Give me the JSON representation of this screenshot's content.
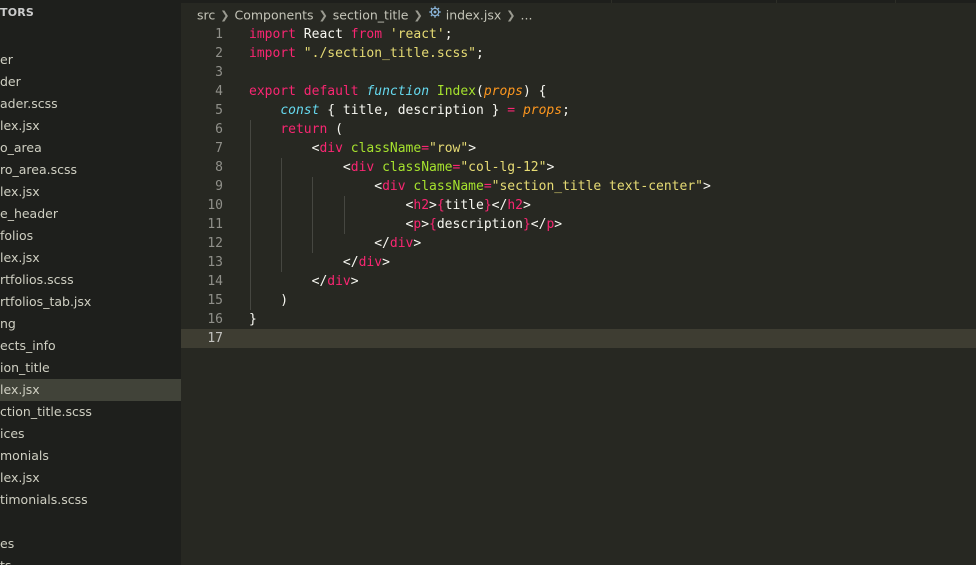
{
  "sidebar": {
    "header": "TORS",
    "items": [
      {
        "label": "er",
        "active": false
      },
      {
        "label": "der",
        "active": false
      },
      {
        "label": "ader.scss",
        "active": false
      },
      {
        "label": "lex.jsx",
        "active": false
      },
      {
        "label": "o_area",
        "active": false
      },
      {
        "label": "ro_area.scss",
        "active": false
      },
      {
        "label": "lex.jsx",
        "active": false
      },
      {
        "label": "e_header",
        "active": false
      },
      {
        "label": "folios",
        "active": false
      },
      {
        "label": "lex.jsx",
        "active": false
      },
      {
        "label": "rtfolios.scss",
        "active": false
      },
      {
        "label": "rtfolios_tab.jsx",
        "active": false
      },
      {
        "label": "ng",
        "active": false
      },
      {
        "label": "ects_info",
        "active": false
      },
      {
        "label": "ion_title",
        "active": false
      },
      {
        "label": "lex.jsx",
        "active": true
      },
      {
        "label": "ction_title.scss",
        "active": false
      },
      {
        "label": "ices",
        "active": false
      },
      {
        "label": "monials",
        "active": false
      },
      {
        "label": "lex.jsx",
        "active": false
      },
      {
        "label": "timonials.scss",
        "active": false
      },
      {
        "label": "",
        "active": false
      },
      {
        "label": "es",
        "active": false
      },
      {
        "label": "ts",
        "active": false
      }
    ]
  },
  "breadcrumb": {
    "parts": [
      "src",
      "Components",
      "section_title",
      "index.jsx",
      "..."
    ],
    "file_icon": "react-gear-icon"
  },
  "editor": {
    "current_line": 17,
    "line_numbers": [
      "1",
      "2",
      "3",
      "4",
      "5",
      "6",
      "7",
      "8",
      "9",
      "10",
      "11",
      "12",
      "13",
      "14",
      "15",
      "16",
      "17"
    ],
    "lines": [
      [
        [
          "kw",
          "import"
        ],
        [
          "pl",
          " React "
        ],
        [
          "kw",
          "from"
        ],
        [
          "pl",
          " "
        ],
        [
          "str",
          "'react'"
        ],
        [
          "pl",
          ";"
        ]
      ],
      [
        [
          "kw",
          "import"
        ],
        [
          "pl",
          " "
        ],
        [
          "str",
          "\"./section_title.scss\""
        ],
        [
          "pl",
          ";"
        ]
      ],
      [],
      [
        [
          "kw",
          "export"
        ],
        [
          "pl",
          " "
        ],
        [
          "kw",
          "default"
        ],
        [
          "pl",
          " "
        ],
        [
          "it",
          "function"
        ],
        [
          "pl",
          " "
        ],
        [
          "fn",
          "Index"
        ],
        [
          "pl",
          "("
        ],
        [
          "param",
          "props"
        ],
        [
          "pl",
          ") {"
        ]
      ],
      [
        [
          "pl",
          "    "
        ],
        [
          "it",
          "const"
        ],
        [
          "pl",
          " { title, description } "
        ],
        [
          "kw",
          "="
        ],
        [
          "pl",
          " "
        ],
        [
          "param",
          "props"
        ],
        [
          "pl",
          ";"
        ]
      ],
      [
        [
          "pl",
          "    "
        ],
        [
          "kw",
          "return"
        ],
        [
          "pl",
          " ("
        ]
      ],
      [
        [
          "pl",
          "        <"
        ],
        [
          "tag",
          "div"
        ],
        [
          "pl",
          " "
        ],
        [
          "attr",
          "className"
        ],
        [
          "kw",
          "="
        ],
        [
          "str",
          "\"row\""
        ],
        [
          "pl",
          ">"
        ]
      ],
      [
        [
          "pl",
          "            <"
        ],
        [
          "tag",
          "div"
        ],
        [
          "pl",
          " "
        ],
        [
          "attr",
          "className"
        ],
        [
          "kw",
          "="
        ],
        [
          "str",
          "\"col-lg-12\""
        ],
        [
          "pl",
          ">"
        ]
      ],
      [
        [
          "pl",
          "                <"
        ],
        [
          "tag",
          "div"
        ],
        [
          "pl",
          " "
        ],
        [
          "attr",
          "className"
        ],
        [
          "kw",
          "="
        ],
        [
          "str",
          "\"section_title text-center\""
        ],
        [
          "pl",
          ">"
        ]
      ],
      [
        [
          "pl",
          "                    <"
        ],
        [
          "tag",
          "h2"
        ],
        [
          "pl",
          ">"
        ],
        [
          "br",
          "{"
        ],
        [
          "pl",
          "title"
        ],
        [
          "br",
          "}"
        ],
        [
          "pl",
          "</"
        ],
        [
          "tag",
          "h2"
        ],
        [
          "pl",
          ">"
        ]
      ],
      [
        [
          "pl",
          "                    <"
        ],
        [
          "tag",
          "p"
        ],
        [
          "pl",
          ">"
        ],
        [
          "br",
          "{"
        ],
        [
          "pl",
          "description"
        ],
        [
          "br",
          "}"
        ],
        [
          "pl",
          "</"
        ],
        [
          "tag",
          "p"
        ],
        [
          "pl",
          ">"
        ]
      ],
      [
        [
          "pl",
          "                </"
        ],
        [
          "tag",
          "div"
        ],
        [
          "pl",
          ">"
        ]
      ],
      [
        [
          "pl",
          "            </"
        ],
        [
          "tag",
          "div"
        ],
        [
          "pl",
          ">"
        ]
      ],
      [
        [
          "pl",
          "        </"
        ],
        [
          "tag",
          "div"
        ],
        [
          "pl",
          ">"
        ]
      ],
      [
        [
          "pl",
          "    )"
        ]
      ],
      [
        [
          "pl",
          "}"
        ]
      ],
      []
    ]
  },
  "colors": {
    "editor_bg": "#272822",
    "sidebar_bg": "#1e1f1c",
    "active_item_bg": "#414339",
    "keyword": "#f92672",
    "string": "#e6db74",
    "function": "#a6e22e",
    "storage": "#66d9ef",
    "parameter": "#fd971f"
  }
}
